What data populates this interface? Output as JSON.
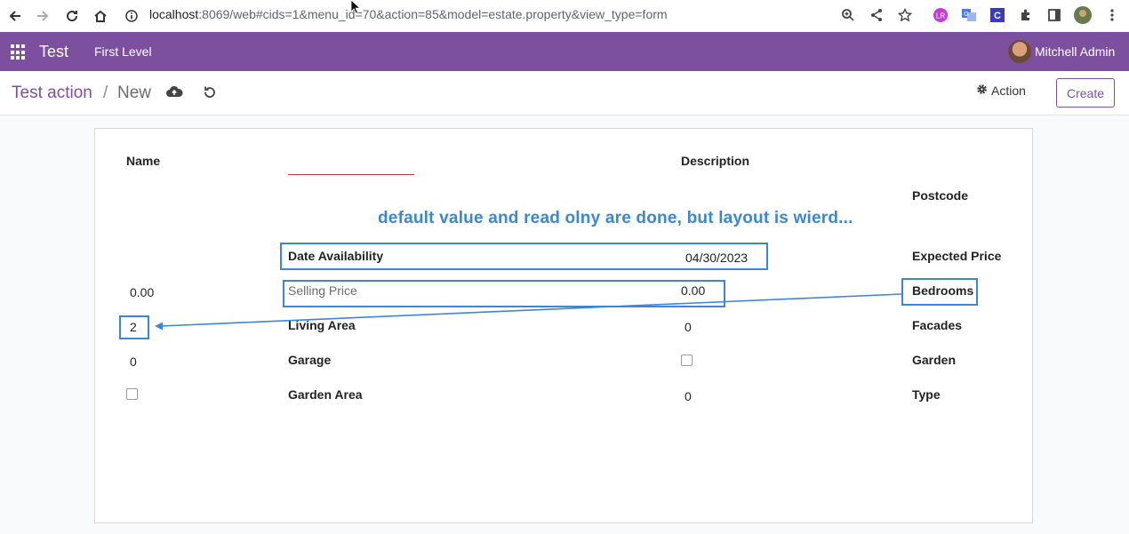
{
  "browser": {
    "url_host": "localhost",
    "url_path": ":8069/web#cids=1&menu_id=70&action=85&model=estate.property&view_type=form"
  },
  "topnav": {
    "app_name": "Test",
    "menu_item": "First Level",
    "user_name": "Mitchell Admin"
  },
  "control": {
    "breadcrumb_root": "Test action",
    "breadcrumb_sep": "/",
    "breadcrumb_current": "New",
    "action_label": "Action",
    "create_label": "Create"
  },
  "form": {
    "name_label": "Name",
    "description_label": "Description",
    "postcode_label": "Postcode",
    "date_availability_label": "Date Availability",
    "date_availability_value": "04/30/2023",
    "expected_price_label": "Expected Price",
    "expected_price_value": "0.00",
    "selling_price_label": "Selling Price",
    "selling_price_value": "0.00",
    "bedrooms_label": "Bedrooms",
    "bedrooms_value": "2",
    "living_area_label": "Living Area",
    "living_area_value": "0",
    "facades_label": "Facades",
    "facades_value": "0",
    "garage_label": "Garage",
    "garden_label": "Garden",
    "garden_area_label": "Garden Area",
    "garden_area_value": "0",
    "type_label": "Type"
  },
  "annotation": {
    "text": "default value and read olny are done, but layout is wierd..."
  },
  "colors": {
    "brand": "#7c4f9f",
    "annotation": "#3a87d6"
  }
}
